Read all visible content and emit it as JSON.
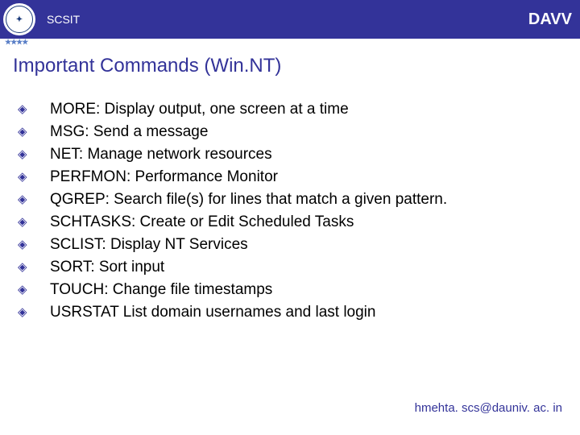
{
  "header": {
    "left": "SCSIT",
    "right": "DAVV",
    "stars": "★★★★"
  },
  "title": "Important Commands (Win.NT)",
  "bullets": [
    "MORE: Display output, one screen at a time",
    "MSG: Send a message",
    "NET: Manage network resources",
    "PERFMON:  Performance Monitor",
    "QGREP: Search file(s) for lines that match a given pattern.",
    "SCHTASKS: Create or Edit Scheduled Tasks",
    "SCLIST:   Display NT Services",
    "SORT: Sort input",
    "TOUCH: Change file timestamps",
    "USRSTAT  List domain usernames and last login"
  ],
  "footer": "hmehta. scs@dauniv. ac. in",
  "bullet_glyph": "◈"
}
